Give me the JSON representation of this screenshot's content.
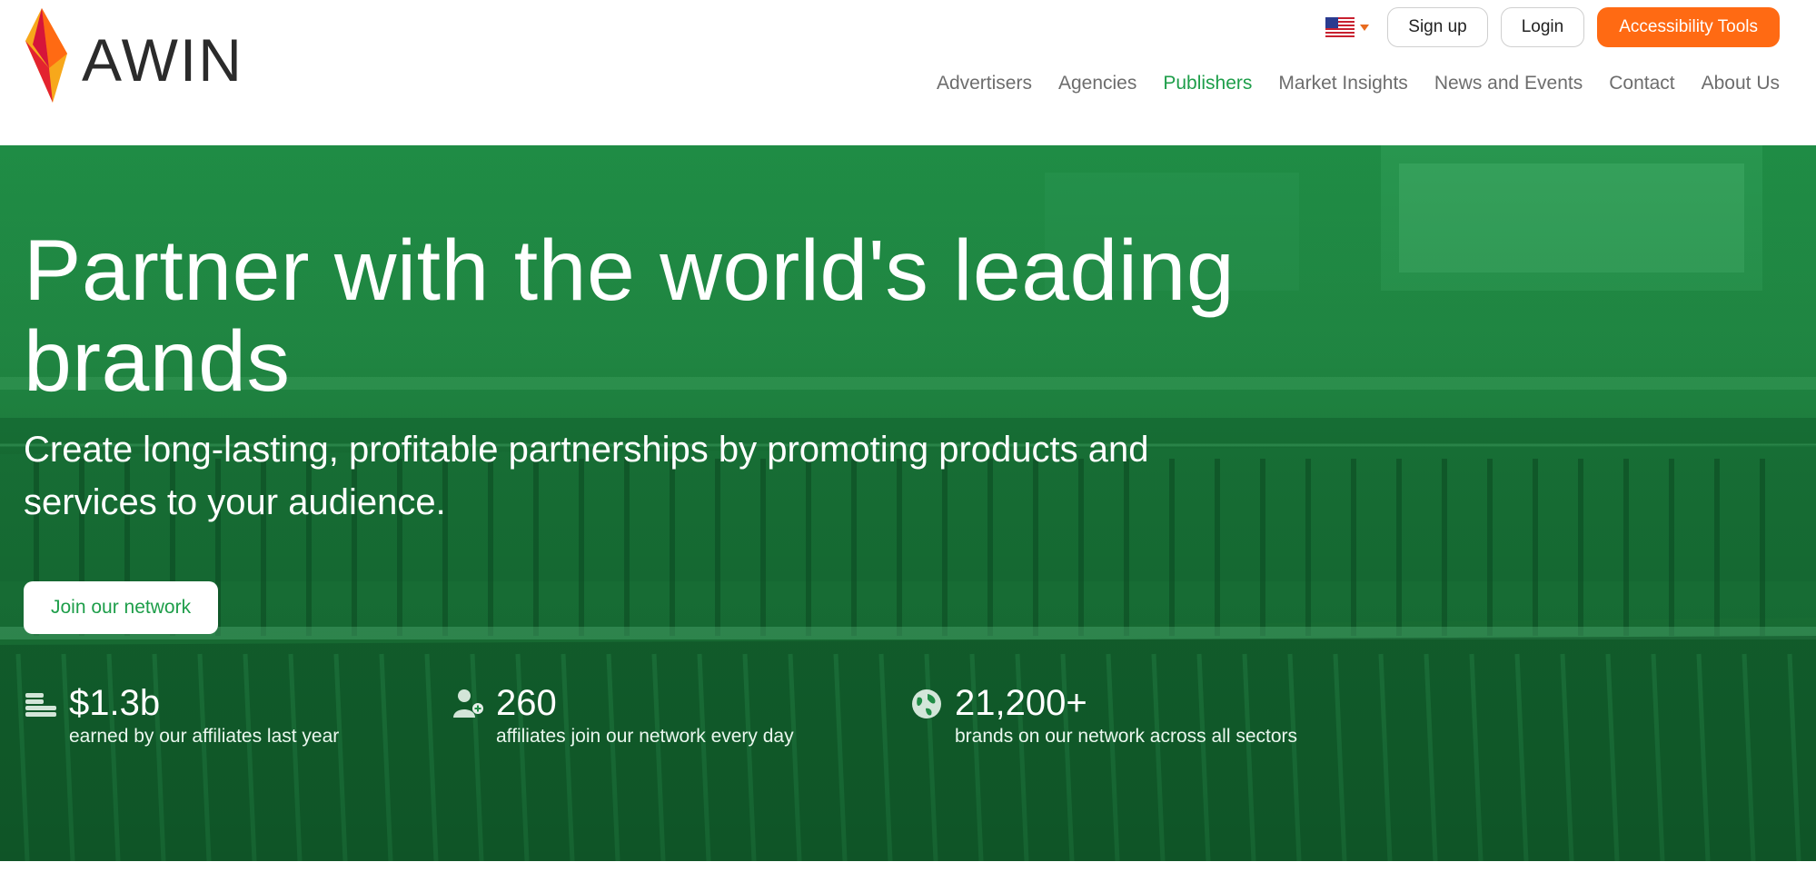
{
  "brand": {
    "name": "AWIN"
  },
  "colors": {
    "accent": "#ff6a13",
    "brand_green": "#1e9e4a",
    "hero_green": "#1f8c45"
  },
  "header": {
    "locale_icon": "us-flag-icon",
    "signup_label": "Sign up",
    "login_label": "Login",
    "accessibility_label": "Accessibility Tools"
  },
  "nav": {
    "items": [
      {
        "label": "Advertisers",
        "active": false
      },
      {
        "label": "Agencies",
        "active": false
      },
      {
        "label": "Publishers",
        "active": true
      },
      {
        "label": "Market Insights",
        "active": false
      },
      {
        "label": "News and Events",
        "active": false
      },
      {
        "label": "Contact",
        "active": false
      },
      {
        "label": "About Us",
        "active": false
      }
    ]
  },
  "hero": {
    "title": "Partner with the world's leading brands",
    "subtitle": "Create long-lasting, profitable partnerships by promoting products and services to your audience.",
    "cta_label": "Join our network"
  },
  "stats": [
    {
      "icon": "coins-icon",
      "value": "$1.3b",
      "description": "earned by our affiliates last year"
    },
    {
      "icon": "user-plus-icon",
      "value": "260",
      "description": "affiliates join our network every day"
    },
    {
      "icon": "globe-icon",
      "value": "21,200+",
      "description": "brands on our network across all sectors"
    }
  ]
}
